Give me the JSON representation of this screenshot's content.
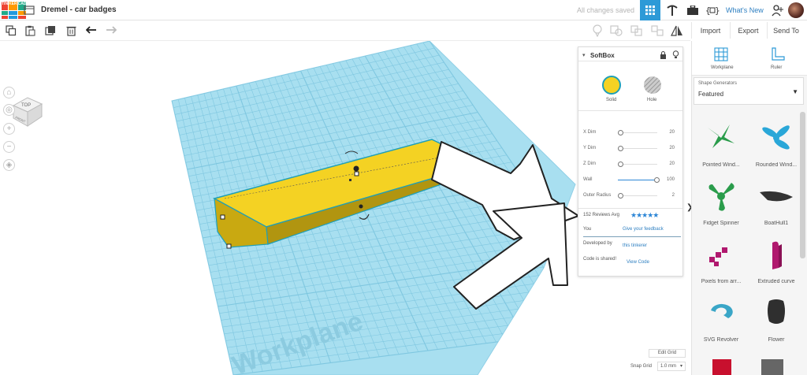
{
  "app": {
    "logo_letters": [
      "TIN",
      "KER",
      "CAD",
      "",
      "",
      "",
      "",
      "",
      ""
    ],
    "document_title": "Dremel - car badges",
    "save_status": "All changes saved",
    "whats_new": "What's New"
  },
  "toolbar": {
    "import": "Import",
    "export": "Export",
    "send_to": "Send To"
  },
  "viewport": {
    "viewcube_top": "TOP",
    "viewcube_front": "FRONT",
    "workplane_watermark": "Workplane"
  },
  "inspector": {
    "title": "SoftBox",
    "solid": "Solid",
    "hole": "Hole",
    "params": [
      {
        "name": "X Dim",
        "value": "20",
        "level": 0.0
      },
      {
        "name": "Y Dim",
        "value": "20",
        "level": 0.0
      },
      {
        "name": "Z Dim",
        "value": "20",
        "level": 0.0
      },
      {
        "name": "Wall",
        "value": "100",
        "level": 1.0
      },
      {
        "name": "Outer Radius",
        "value": "2",
        "level": 0.0
      }
    ],
    "reviews": "152 Reviews Avg",
    "rating_stars": "★★★★★",
    "you": "You",
    "give_feedback": "Give your feedback",
    "developed_by": "Developed by",
    "developer": "this tinkerer",
    "code_shared": "Code is shared!",
    "view_code": "View Code"
  },
  "grid": {
    "edit_grid": "Edit Grid",
    "snap_grid_label": "Snap Grid",
    "snap_grid_value": "1.0 mm"
  },
  "right_panel": {
    "workplane": "Workplane",
    "ruler": "Ruler",
    "library_caption": "Shape Generators",
    "library_value": "Featured",
    "shapes": [
      {
        "name": "Pointed Wind...",
        "icon": "pointed-windmill-icon"
      },
      {
        "name": "Rounded Wind...",
        "icon": "rounded-windmill-icon"
      },
      {
        "name": "Fidget Spinner",
        "icon": "fidget-spinner-icon"
      },
      {
        "name": "BoatHull1",
        "icon": "boat-hull-icon"
      },
      {
        "name": "Pixels from arr...",
        "icon": "pixels-icon"
      },
      {
        "name": "Extruded curve",
        "icon": "extruded-curve-icon"
      },
      {
        "name": "SVG Revolver",
        "icon": "svg-revolver-icon"
      },
      {
        "name": "Flower",
        "icon": "flower-icon"
      }
    ]
  },
  "colors": {
    "accent_blue": "#2d9ad7",
    "solid_yellow": "#f4d223",
    "workplane_blue": "#a8dff0",
    "shape_green": "#2a9c4b",
    "shape_blue": "#2aa7d8",
    "shape_magenta": "#b0186e"
  }
}
